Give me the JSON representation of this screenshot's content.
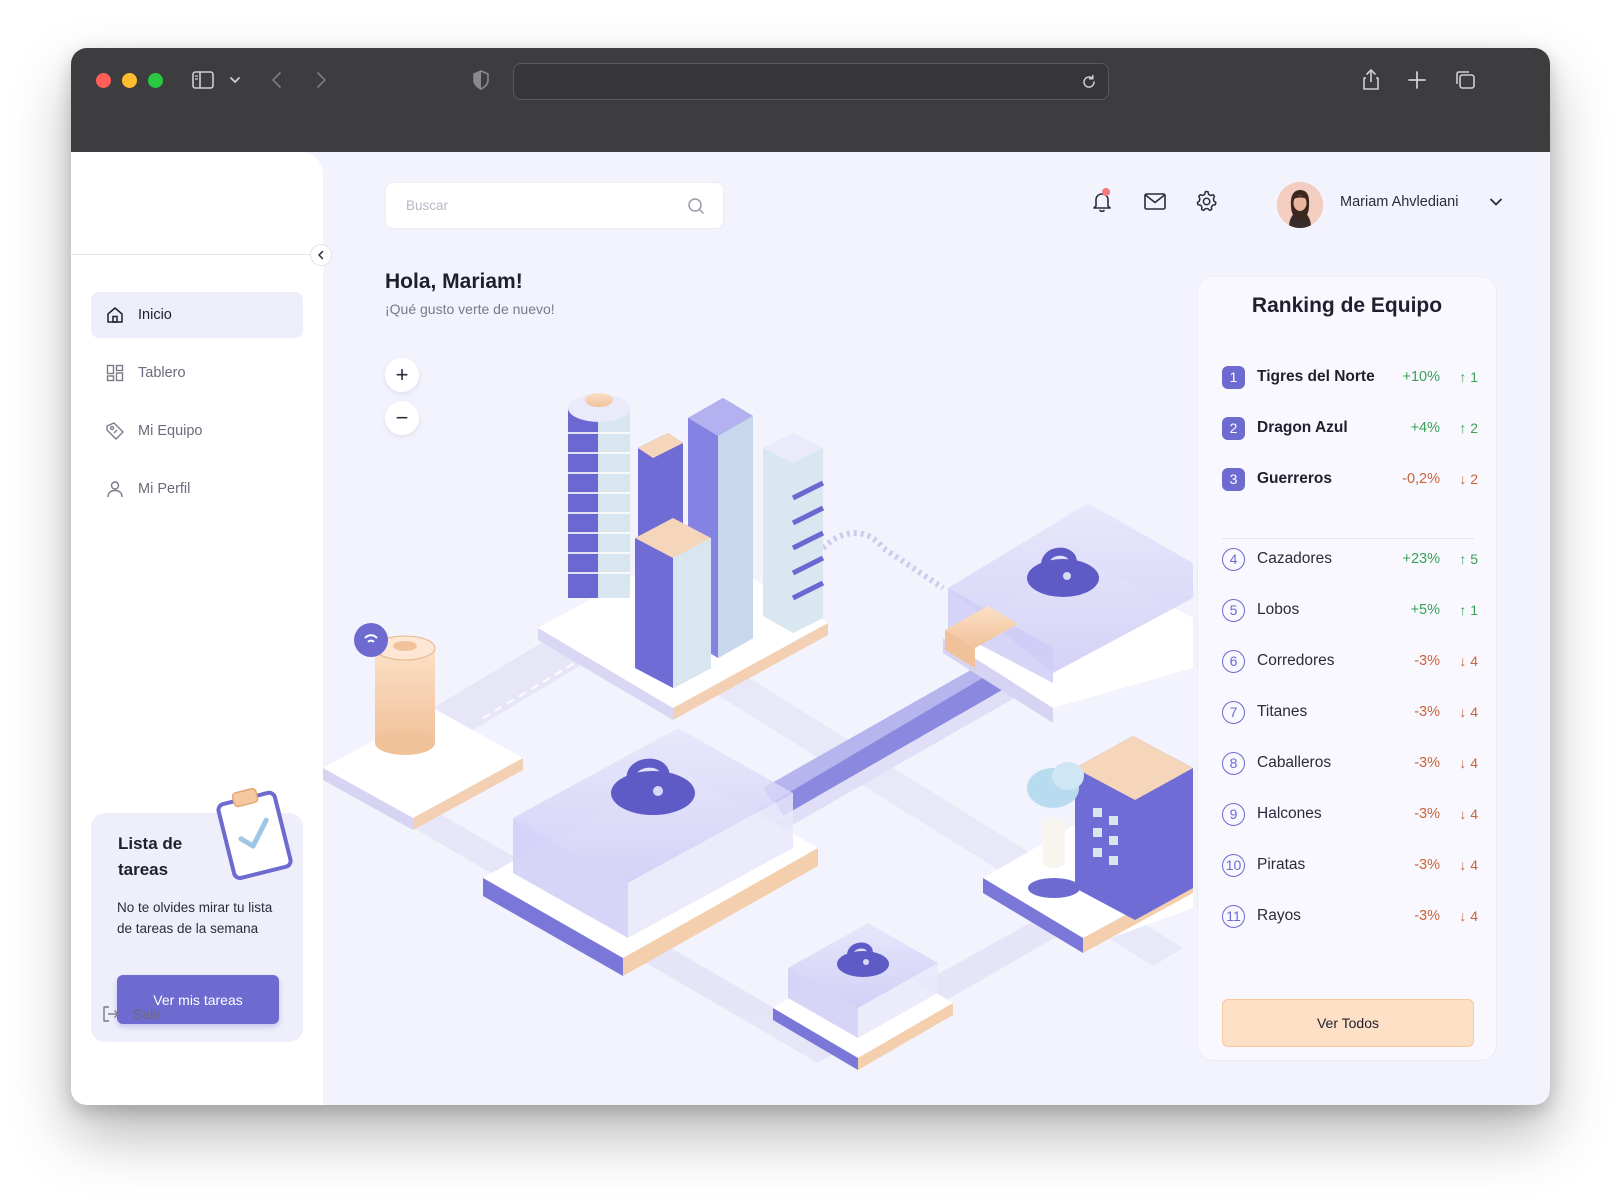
{
  "browser": {
    "url": ""
  },
  "header": {
    "search_placeholder": "Buscar",
    "user_name": "Mariam Ahvlediani"
  },
  "sidebar": {
    "items": [
      {
        "label": "Inicio",
        "icon": "home-icon",
        "active": true
      },
      {
        "label": "Tablero",
        "icon": "dashboard-icon",
        "active": false
      },
      {
        "label": "Mi Equipo",
        "icon": "team-icon",
        "active": false
      },
      {
        "label": "Mi Perfil",
        "icon": "user-icon",
        "active": false
      }
    ],
    "tasks_card": {
      "title": "Lista de tareas",
      "description": "No te olvides mirar tu lista de tareas de la semana",
      "button_label": "Ver mis tareas"
    },
    "logout_label": "Salir"
  },
  "main": {
    "greeting": "Hola, Mariam!",
    "subgreeting": "¡Qué gusto verte de nuevo!",
    "zoom_in": "+",
    "zoom_out": "−"
  },
  "ranking": {
    "title": "Ranking de Equipo",
    "teams": [
      {
        "rank": "1",
        "name": "Tigres del Norte",
        "change": "+10%",
        "move": "↑ 1",
        "trend": "up"
      },
      {
        "rank": "2",
        "name": "Dragon Azul",
        "change": "+4%",
        "move": "↑ 2",
        "trend": "up"
      },
      {
        "rank": "3",
        "name": "Guerreros",
        "change": "-0,2%",
        "move": "↓ 2",
        "trend": "down"
      },
      {
        "rank": "4",
        "name": "Cazadores",
        "change": "+23%",
        "move": "↑ 5",
        "trend": "up"
      },
      {
        "rank": "5",
        "name": "Lobos",
        "change": "+5%",
        "move": "↑ 1",
        "trend": "up"
      },
      {
        "rank": "6",
        "name": "Corredores",
        "change": "-3%",
        "move": "↓ 4",
        "trend": "down"
      },
      {
        "rank": "7",
        "name": "Titanes",
        "change": "-3%",
        "move": "↓ 4",
        "trend": "down"
      },
      {
        "rank": "8",
        "name": "Caballeros",
        "change": "-3%",
        "move": "↓ 4",
        "trend": "down"
      },
      {
        "rank": "9",
        "name": "Halcones",
        "change": "-3%",
        "move": "↓ 4",
        "trend": "down"
      },
      {
        "rank": "10",
        "name": "Piratas",
        "change": "-3%",
        "move": "↓ 4",
        "trend": "down"
      },
      {
        "rank": "11",
        "name": "Rayos",
        "change": "-3%",
        "move": "↓ 4",
        "trend": "down"
      }
    ],
    "view_all_label": "Ver Todos"
  },
  "colors": {
    "accent": "#6d6ad0",
    "up": "#3aa05a",
    "down": "#c8643a",
    "button_peach": "#fde0c6"
  }
}
